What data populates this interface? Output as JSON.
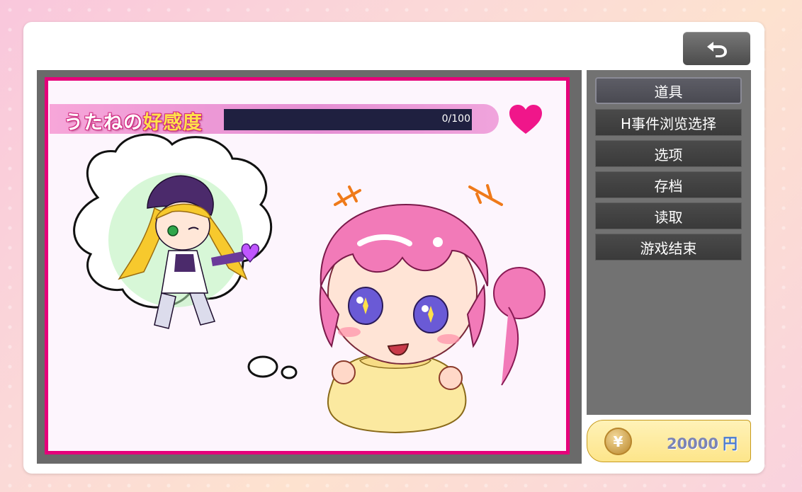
{
  "affection": {
    "title_prefix": "うたねの",
    "title_highlight": "好感度",
    "value": 0,
    "max": 100,
    "display": "0/100"
  },
  "menu": {
    "items": [
      {
        "label": "道具",
        "active": true
      },
      {
        "label": "H事件浏览选择",
        "active": false
      },
      {
        "label": "选项",
        "active": false
      },
      {
        "label": "存档",
        "active": false
      },
      {
        "label": "读取",
        "active": false
      },
      {
        "label": "游戏结束",
        "active": false
      }
    ]
  },
  "money": {
    "symbol": "¥",
    "amount": "20000",
    "unit": "円"
  },
  "icons": {
    "back": "back-arrow-icon",
    "heart": "heart-icon",
    "coin": "yen-coin-icon"
  },
  "colors": {
    "accent": "#e5007a",
    "menu_bg": "#3a3a3a",
    "meter_bg": "#1f2040"
  }
}
